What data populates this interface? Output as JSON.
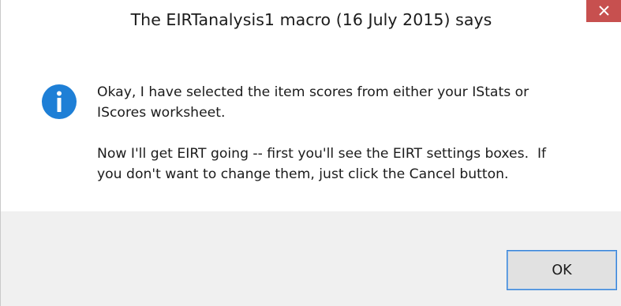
{
  "dialog": {
    "title": "The EIRTanalysis1 macro (16 July 2015) says",
    "close_icon": "close-icon",
    "info_icon": "info-icon",
    "message_paragraphs": [
      "Okay, I have selected the item scores from either your IStats or\nIScores worksheet.",
      "Now I'll get EIRT going -- first you'll see the EIRT settings boxes.  If\nyou don't want to change them, just click the Cancel button."
    ],
    "ok_label": "OK"
  },
  "colors": {
    "close_button": "#c7504f",
    "info_icon": "#1e7fd6",
    "footer_background": "#f0f0f0",
    "ok_border": "#3a84d6"
  }
}
